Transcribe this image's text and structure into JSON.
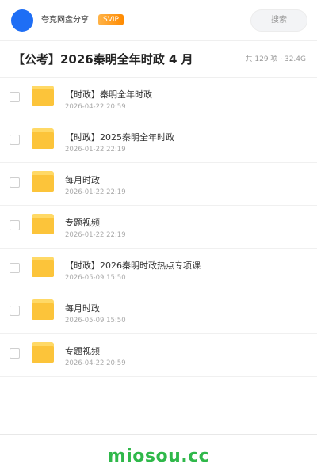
{
  "header": {
    "share_name": "夸克网盘分享",
    "badge": "SVIP",
    "search_placeholder": "搜索",
    "avatar_color": "#1e6ef5"
  },
  "share": {
    "title": "【公考】2026秦明全年时政 4 月",
    "summary": "共 129 项 · 32.4G"
  },
  "files": [
    {
      "name": "【时政】秦明全年时政",
      "date": "2026-04-22 20:59",
      "icon": "folder-icon"
    },
    {
      "name": "【时政】2025秦明全年时政",
      "date": "2026-01-22 22:19",
      "icon": "folder-icon"
    },
    {
      "name": "每月时政",
      "date": "2026-01-22 22:19",
      "icon": "folder-icon"
    },
    {
      "name": "专题视频",
      "date": "2026-01-22 22:19",
      "icon": "folder-icon"
    },
    {
      "name": "【时政】2026秦明时政热点专项课",
      "date": "2026-05-09 15:50",
      "icon": "folder-icon"
    },
    {
      "name": "每月时政",
      "date": "2026-05-09 15:50",
      "icon": "folder-icon"
    },
    {
      "name": "专题视频",
      "date": "2026-04-22 20:59",
      "icon": "folder-icon"
    }
  ],
  "footer": {
    "watermark": "miosou.cc",
    "watermark_color": "#2fb84a"
  }
}
